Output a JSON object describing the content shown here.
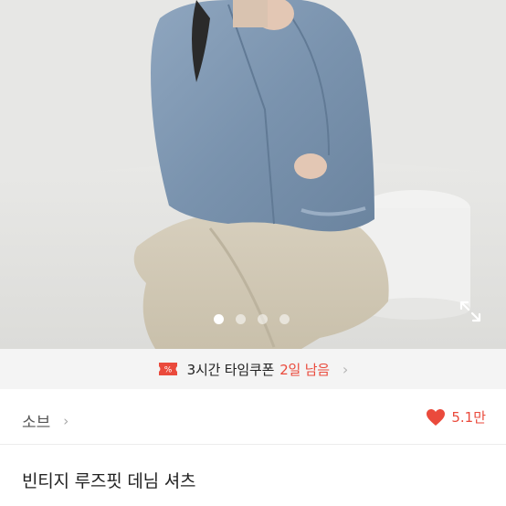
{
  "product_image": {
    "description_icon": "product-photo",
    "carousel": {
      "total": 4,
      "active_index": 0
    },
    "expand_icon": "expand-icon"
  },
  "coupon": {
    "icon": "coupon-icon",
    "label": "3시간 타임쿠폰",
    "highlight": "2일 남음",
    "accent_color": "#ea4a3c"
  },
  "store": {
    "name": "소브",
    "chevron": "›"
  },
  "likes": {
    "icon": "heart-icon",
    "count": "5.1만",
    "color": "#ea4a3c"
  },
  "product": {
    "title": "빈티지 루즈핏 데님 셔츠"
  }
}
